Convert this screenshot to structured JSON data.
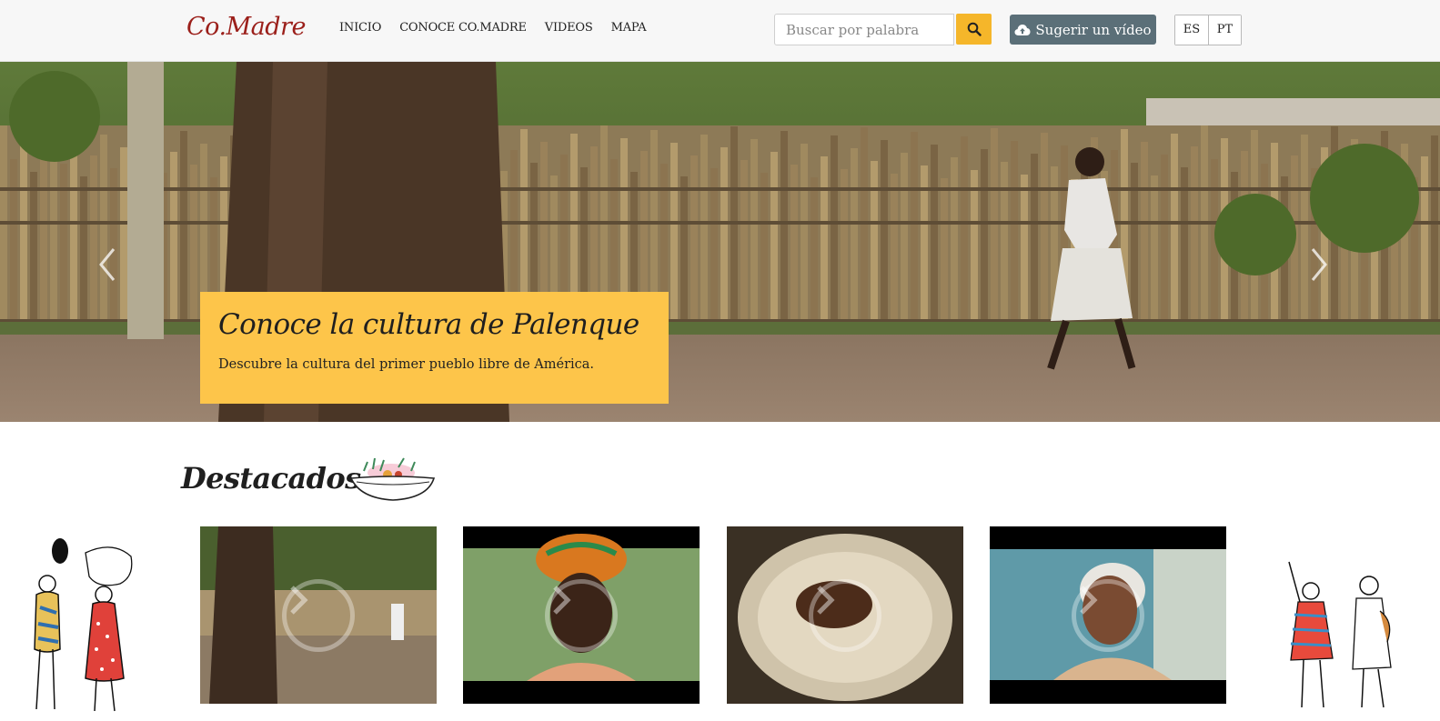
{
  "header": {
    "logo": "Co.Madre",
    "nav": [
      "INICIO",
      "CONOCE CO.MADRE",
      "VIDEOS",
      "MAPA"
    ],
    "search_placeholder": "Buscar por palabra",
    "search_icon": "search-icon",
    "suggest_label": "Sugerir un vídeo",
    "suggest_icon": "cloud-upload-icon",
    "languages": [
      "ES",
      "PT"
    ]
  },
  "hero": {
    "title": "Conoce la cultura de Palenque",
    "subtitle": "Descubre la cultura del primer pueblo libre de América.",
    "prev_icon": "chevron-left-icon",
    "next_icon": "chevron-right-icon",
    "caption_color": "#fdc54a"
  },
  "featured": {
    "title": "Destacados",
    "cards": [
      {
        "thumb": "palenque-street-fence",
        "icon": "play-icon"
      },
      {
        "thumb": "woman-headwrap",
        "icon": "play-icon"
      },
      {
        "thumb": "bowl-food",
        "icon": "play-icon"
      },
      {
        "thumb": "elderly-woman",
        "icon": "play-icon"
      }
    ]
  },
  "colors": {
    "logo": "#9b1f1a",
    "accent_yellow": "#fdc54a",
    "search_button": "#f5b62a",
    "suggest_button": "#5b6f78"
  }
}
